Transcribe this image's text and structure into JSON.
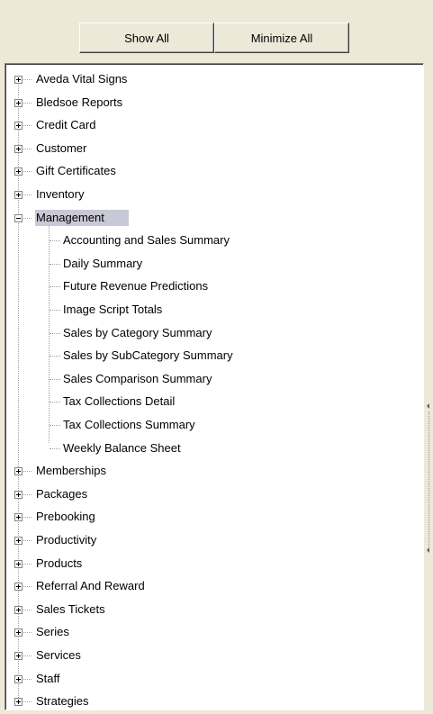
{
  "toolbar": {
    "show_all_label": "Show All",
    "minimize_all_label": "Minimize All"
  },
  "tree": {
    "items": [
      {
        "label": "Aveda Vital Signs",
        "expanded": false
      },
      {
        "label": "Bledsoe Reports",
        "expanded": false
      },
      {
        "label": "Credit Card",
        "expanded": false
      },
      {
        "label": "Customer",
        "expanded": false
      },
      {
        "label": "Gift Certificates",
        "expanded": false
      },
      {
        "label": "Inventory",
        "expanded": false
      },
      {
        "label": "Management",
        "expanded": true,
        "selected": true,
        "children": [
          "Accounting and Sales Summary",
          "Daily Summary",
          "Future Revenue Predictions",
          "Image Script Totals",
          "Sales by Category Summary",
          "Sales by SubCategory Summary",
          "Sales Comparison Summary",
          "Tax Collections Detail",
          "Tax Collections Summary",
          "Weekly Balance Sheet"
        ]
      },
      {
        "label": "Memberships",
        "expanded": false
      },
      {
        "label": "Packages",
        "expanded": false
      },
      {
        "label": "Prebooking",
        "expanded": false
      },
      {
        "label": "Productivity",
        "expanded": false
      },
      {
        "label": "Products",
        "expanded": false
      },
      {
        "label": "Referral And Reward",
        "expanded": false
      },
      {
        "label": "Sales Tickets",
        "expanded": false
      },
      {
        "label": "Series",
        "expanded": false
      },
      {
        "label": "Services",
        "expanded": false
      },
      {
        "label": "Staff",
        "expanded": false
      },
      {
        "label": "Strategies",
        "expanded": false
      }
    ]
  },
  "colors": {
    "window_bg": "#ece9d8",
    "tree_bg": "#ffffff",
    "selection_bg": "#c8c8d6"
  }
}
